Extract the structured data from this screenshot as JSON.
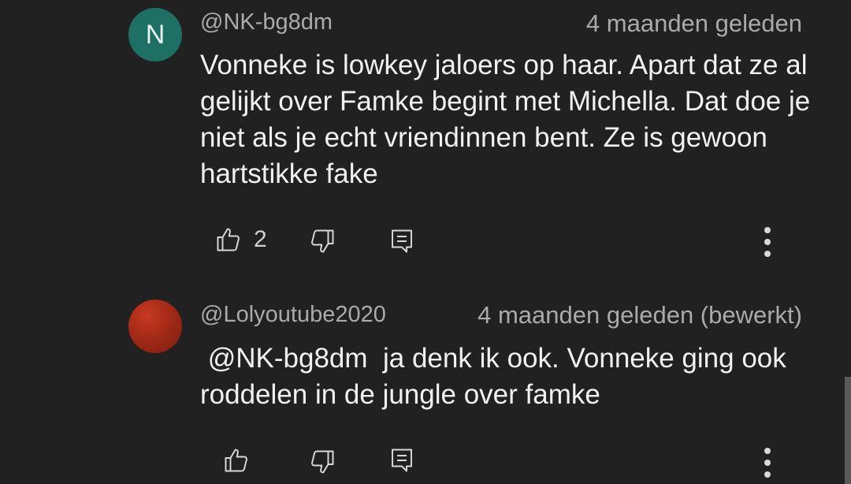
{
  "comments": [
    {
      "avatar_letter": "N",
      "avatar_color": "#1e6f64",
      "author": "@NK-bg8dm",
      "timestamp": "4 maanden geleden",
      "text": "Vonneke is lowkey jaloers op haar. Apart dat ze al gelijkt over Famke begint met Michella. Dat doe je niet als je echt vriendinnen bent. Ze is gewoon hartstikke fake",
      "like_count": "2",
      "icons": [
        "thumbs-up-icon",
        "thumbs-down-icon",
        "reply-icon",
        "more-vertical-icon"
      ]
    },
    {
      "avatar_letter": "",
      "avatar_color": "#a32a17",
      "author": "@Lolyoutube2020",
      "timestamp": "4 maanden geleden (bewerkt)",
      "text": " @NK-bg8dm  ja denk ik ook. Vonneke ging ook roddelen in de jungle over famke",
      "like_count": "",
      "icons": [
        "thumbs-up-icon",
        "thumbs-down-icon",
        "reply-icon",
        "more-vertical-icon"
      ]
    }
  ],
  "theme": {
    "background": "#212121",
    "text": "#f1f1f1",
    "secondary_text": "#aaaaaa"
  }
}
